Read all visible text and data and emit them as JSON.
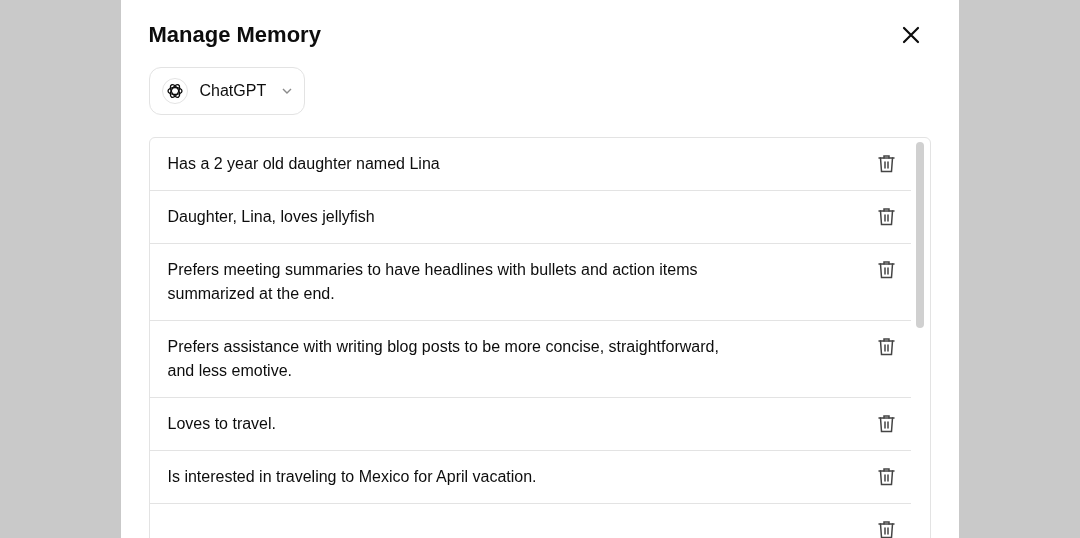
{
  "dialog": {
    "title": "Manage Memory"
  },
  "model_selector": {
    "label": "ChatGPT"
  },
  "memories": [
    {
      "text": "Has a 2 year old daughter named Lina"
    },
    {
      "text": "Daughter, Lina, loves jellyfish"
    },
    {
      "text": "Prefers meeting summaries to have headlines with bullets and action items summarized at the end."
    },
    {
      "text": "Prefers assistance with writing blog posts to be more concise, straightforward, and less emotive."
    },
    {
      "text": "Loves to travel."
    },
    {
      "text": "Is interested in traveling to Mexico for April vacation."
    }
  ]
}
